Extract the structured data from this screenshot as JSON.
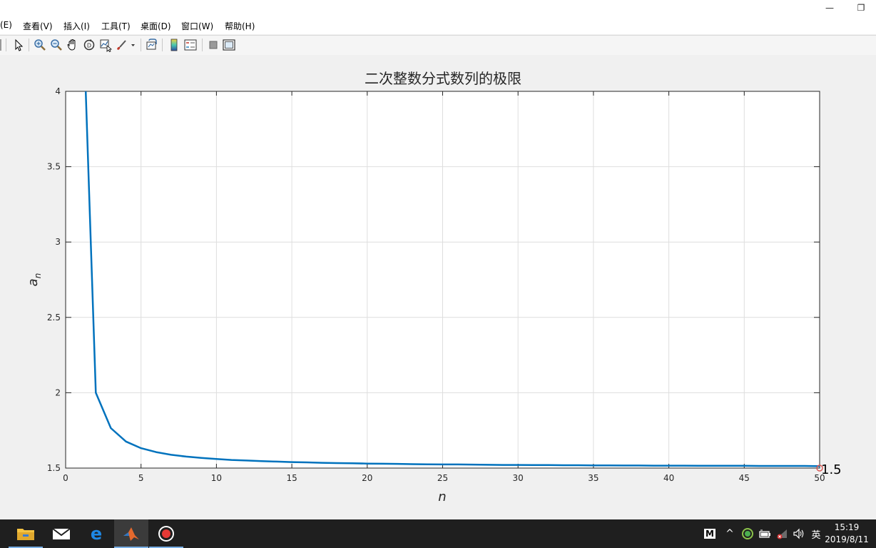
{
  "window": {
    "minimize_glyph": "—",
    "restore_glyph": "❐"
  },
  "menubar": {
    "items": [
      "(E)",
      "查看(V)",
      "插入(I)",
      "工具(T)",
      "桌面(D)",
      "窗口(W)",
      "帮助(H)"
    ]
  },
  "toolbar": {
    "buttons": [
      "pointer-icon",
      "zoom-in-icon",
      "zoom-out-icon",
      "pan-icon",
      "rotate-3d-icon",
      "data-cursor-icon",
      "brush-icon",
      "link-plot-icon",
      "colorbar-icon",
      "legend-icon",
      "hide-plot-tools-icon",
      "show-plot-tools-icon"
    ]
  },
  "chart_data": {
    "type": "line",
    "title": "二次整数分式数列的极限",
    "xlabel": "n",
    "ylabel_main": "a",
    "ylabel_sub": "n",
    "xlim": [
      0,
      50
    ],
    "ylim": [
      1.5,
      4
    ],
    "xticks": [
      0,
      5,
      10,
      15,
      20,
      25,
      30,
      35,
      40,
      45,
      50
    ],
    "yticks": [
      1.5,
      2,
      2.5,
      3,
      3.5,
      4
    ],
    "ytick_labels": [
      "1.5",
      "2",
      "2.5",
      "3",
      "3.5",
      "4"
    ],
    "grid": true,
    "line_color": "#0072bd",
    "marker_color": "#d9534f",
    "series": [
      {
        "x": [
          1,
          2,
          3,
          4,
          5,
          6,
          7,
          8,
          9,
          10,
          11,
          12,
          13,
          14,
          15,
          16,
          17,
          18,
          19,
          20,
          21,
          22,
          23,
          24,
          25,
          26,
          27,
          28,
          29,
          30,
          31,
          32,
          33,
          34,
          35,
          36,
          37,
          38,
          39,
          40,
          41,
          42,
          43,
          44,
          45,
          46,
          47,
          48,
          49,
          50
        ],
        "y": [
          5,
          2,
          1.765,
          1.676,
          1.632,
          1.606,
          1.588,
          1.576,
          1.567,
          1.56,
          1.554,
          1.55,
          1.546,
          1.543,
          1.54,
          1.538,
          1.535,
          1.533,
          1.532,
          1.53,
          1.529,
          1.528,
          1.526,
          1.525,
          1.524,
          1.524,
          1.523,
          1.522,
          1.521,
          1.521,
          1.52,
          1.52,
          1.519,
          1.519,
          1.518,
          1.518,
          1.517,
          1.517,
          1.516,
          1.516,
          1.516,
          1.515,
          1.515,
          1.515,
          1.515,
          1.514,
          1.514,
          1.514,
          1.514,
          1.513
        ]
      }
    ],
    "annotation": {
      "x": 50,
      "y": 1.5,
      "label": "1.5"
    }
  },
  "taskbar": {
    "apps": [
      "file-explorer-icon",
      "mail-icon",
      "edge-icon",
      "matlab-icon",
      "record-icon"
    ],
    "tray": {
      "m_label": "M",
      "chevron": "^",
      "lang": "英"
    },
    "clock": {
      "time": "15:19",
      "date": "2019/8/11"
    }
  }
}
